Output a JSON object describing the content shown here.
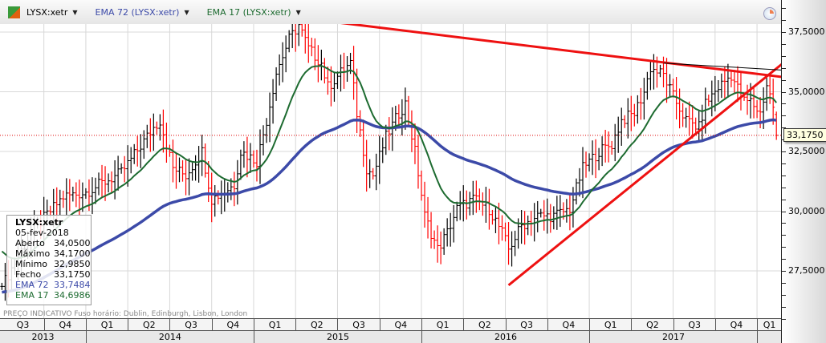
{
  "header": {
    "symbol": "LYSX:xetr",
    "ema72": "EMA 72 (LYSX:xetr)",
    "ema17": "EMA 17 (LYSX:xetr)",
    "logo": "Eq"
  },
  "tooltip": {
    "title": "LYSX:xetr",
    "date": "05-fev-2018",
    "rows": [
      [
        "Aberto",
        "34,0500"
      ],
      [
        "Máximo",
        "34,1700"
      ],
      [
        "Mínimo",
        "32,9850"
      ],
      [
        "Fecho",
        "33,1750"
      ],
      [
        "EMA 72",
        "33,7484"
      ],
      [
        "EMA 17",
        "34,6986"
      ]
    ]
  },
  "footer": "PREÇO INDICATIVO    Fuso horário: Dublin, Edinburgh, Lisbon, London",
  "current_price_label": "33,1750",
  "colors": {
    "up": "#000000",
    "down": "#ff0000",
    "ema72": "#3c4aa8",
    "ema17": "#1d6b30",
    "trend": "#ee1111"
  },
  "chart_data": {
    "type": "ohlc",
    "x_unit": "weeks since Jul 2013",
    "y_ticks": [
      {
        "v": 37.5,
        "label": "37,5000"
      },
      {
        "v": 35,
        "label": "35,0000"
      },
      {
        "v": 32.5,
        "label": "32,5000"
      },
      {
        "v": 30,
        "label": "30,0000"
      },
      {
        "v": 27.5,
        "label": "27,5000"
      }
    ],
    "ylim": [
      25.3,
      38.85
    ],
    "xlim": [
      0,
      241.5
    ],
    "quarters": [
      "Q3",
      "Q4",
      "Q1",
      "Q2",
      "Q3",
      "Q4",
      "Q1",
      "Q2",
      "Q3",
      "Q4",
      "Q1",
      "Q2",
      "Q3",
      "Q4",
      "Q1",
      "Q2",
      "Q3",
      "Q4",
      "Q1"
    ],
    "years": [
      "2013",
      "2014",
      "2015",
      "2016",
      "2017"
    ],
    "close_anchors": [
      [
        1,
        27.1
      ],
      [
        9,
        29.1
      ],
      [
        19,
        30.6
      ],
      [
        26,
        30.8
      ],
      [
        37,
        31.6
      ],
      [
        47,
        33.5
      ],
      [
        49,
        33.8
      ],
      [
        53,
        31.8
      ],
      [
        57,
        31.5
      ],
      [
        62,
        32.5
      ],
      [
        65,
        30.5
      ],
      [
        72,
        31.1
      ],
      [
        74,
        32.5
      ],
      [
        79,
        32.1
      ],
      [
        82,
        33.8
      ],
      [
        85,
        35.8
      ],
      [
        89,
        37.2
      ],
      [
        92,
        37.8
      ],
      [
        95,
        36.8
      ],
      [
        99,
        36.2
      ],
      [
        101,
        35.2
      ],
      [
        105,
        35.8
      ],
      [
        108,
        36.2
      ],
      [
        110,
        34.1
      ],
      [
        113,
        31.8
      ],
      [
        115,
        31.5
      ],
      [
        119,
        33.1
      ],
      [
        123,
        34.1
      ],
      [
        125,
        34.5
      ],
      [
        128,
        32.5
      ],
      [
        131,
        29.8
      ],
      [
        135,
        28.4
      ],
      [
        138,
        29.1
      ],
      [
        141,
        30.1
      ],
      [
        146,
        30.5
      ],
      [
        151,
        30.1
      ],
      [
        155,
        29.1
      ],
      [
        157,
        28.4
      ],
      [
        161,
        29.4
      ],
      [
        166,
        29.8
      ],
      [
        171,
        29.8
      ],
      [
        176,
        30.1
      ],
      [
        180,
        31.8
      ],
      [
        185,
        32.5
      ],
      [
        189,
        32.8
      ],
      [
        192,
        33.8
      ],
      [
        196,
        34.1
      ],
      [
        199,
        35.0
      ],
      [
        201,
        36.0
      ],
      [
        205,
        35.7
      ],
      [
        208,
        34.8
      ],
      [
        212,
        33.8
      ],
      [
        216,
        33.5
      ],
      [
        218,
        34.5
      ],
      [
        222,
        35.2
      ],
      [
        226,
        35.7
      ],
      [
        230,
        34.6
      ],
      [
        232,
        34.6
      ],
      [
        235,
        34.1
      ],
      [
        237,
        35.3
      ],
      [
        239,
        34.4
      ],
      [
        240,
        33.175
      ]
    ],
    "last_bar": {
      "open": 34.05,
      "high": 34.17,
      "low": 32.985,
      "close": 33.175
    },
    "ema72_last": 33.7484,
    "ema17_last": 34.6986,
    "trendlines": [
      {
        "name": "resistance",
        "from": [
          92,
          38.1
        ],
        "to": [
          243,
          35.6
        ],
        "color": "red"
      },
      {
        "name": "support",
        "from": [
          157,
          26.9
        ],
        "to": [
          243,
          36.3
        ],
        "color": "red"
      },
      {
        "name": "thin-resistance",
        "from": [
          205,
          36.2
        ],
        "to": [
          243,
          35.9
        ],
        "color": "black"
      }
    ]
  }
}
